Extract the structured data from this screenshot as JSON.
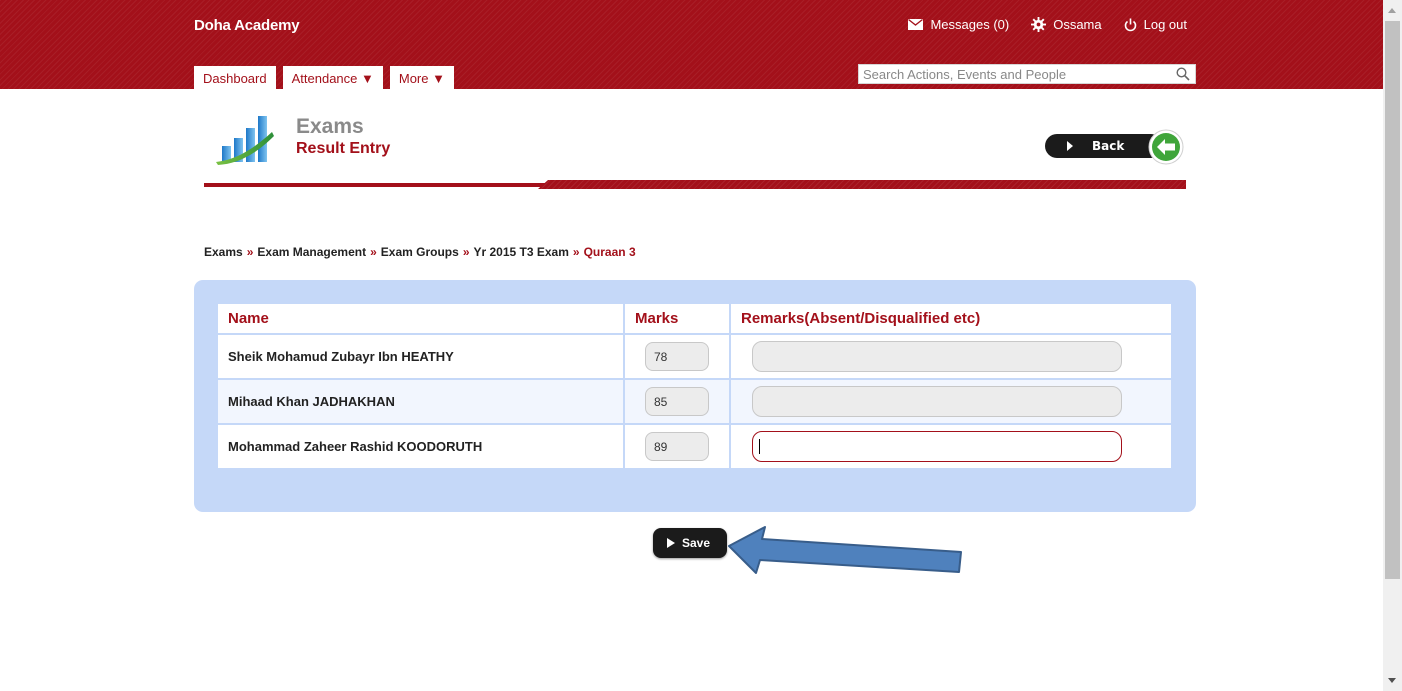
{
  "header": {
    "brand": "Doha Academy",
    "messages_label": "Messages (0)",
    "user_label": "Ossama",
    "logout_label": "Log out",
    "tabs": [
      "Dashboard",
      "Attendance ▼",
      "More ▼"
    ],
    "search_placeholder": "Search Actions, Events and People"
  },
  "page": {
    "title": "Exams",
    "subtitle": "Result Entry",
    "back_label": "Back"
  },
  "breadcrumb": {
    "items": [
      "Exams",
      "Exam Management",
      "Exam Groups",
      "Yr 2015 T3 Exam"
    ],
    "separator": "»",
    "current": "Quraan 3"
  },
  "results": {
    "columns": [
      "Name",
      "Marks",
      "Remarks(Absent/Disqualified etc)"
    ],
    "rows": [
      {
        "name": "Sheik Mohamud Zubayr Ibn HEATHY",
        "marks": "78",
        "remarks": ""
      },
      {
        "name": "Mihaad Khan JADHAKHAN",
        "marks": "85",
        "remarks": ""
      },
      {
        "name": "Mohammad Zaheer Rashid KOODORUTH",
        "marks": "89",
        "remarks": ""
      }
    ]
  },
  "save_label": "Save",
  "colors": {
    "brand_red": "#a3101a",
    "panel_blue": "#c5d8f8",
    "arrow_blue": "#4f81bd",
    "back_green": "#3fa53a"
  },
  "icons": [
    "envelope-icon",
    "gear-icon",
    "power-icon",
    "search-icon",
    "chart-icon",
    "back-arrow-icon"
  ]
}
